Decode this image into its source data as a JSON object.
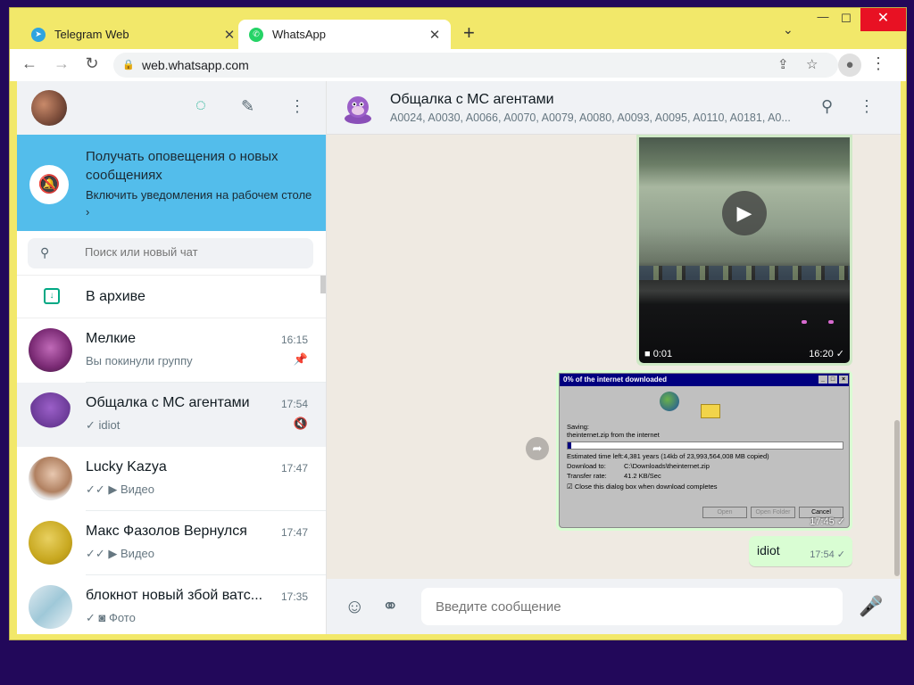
{
  "browser": {
    "tabs": [
      {
        "label": "Telegram Web",
        "active": false,
        "icon": "telegram-icon",
        "color": "#2ea4e0"
      },
      {
        "label": "WhatsApp",
        "active": true,
        "icon": "whatsapp-icon",
        "color": "#25d366"
      }
    ],
    "url": "web.whatsapp.com",
    "frame_color": "#f2e86a"
  },
  "notification": {
    "title": "Получать оповещения о новых сообщениях",
    "link": "Включить уведомления на рабочем столе ›"
  },
  "search": {
    "placeholder": "Поиск или новый чат"
  },
  "archive": {
    "label": "В архиве"
  },
  "chats": [
    {
      "name": "Мелкие",
      "time": "16:15",
      "preview": "Вы покинули группу",
      "right_icon": "pin-icon"
    },
    {
      "name": "Общалка с МС агентами",
      "time": "17:54",
      "preview": "✓ idiot",
      "right_icon": "muted-icon",
      "active": true
    },
    {
      "name": "Lucky Kazya",
      "time": "17:47",
      "preview": "✓✓ ▶ Видео"
    },
    {
      "name": "Макс Фазолов Вернулся",
      "time": "17:47",
      "preview": "✓✓ ▶ Видео"
    },
    {
      "name": "блокнот новый збой ватс...",
      "time": "17:35",
      "preview": "✓ ◙ Фото"
    }
  ],
  "conversation": {
    "title": "Общалка с МС агентами",
    "members": "A0024, A0030, A0066, A0070, A0079, A0080, A0093, A0095, A0110, A0181, A0...",
    "messages": [
      {
        "type": "video",
        "duration": "0:01",
        "time": "16:20 ✓"
      },
      {
        "type": "image",
        "time": "17:45 ✓",
        "dialog": {
          "title": "0% of the internet downloaded",
          "saving": "Saving:",
          "file": "theinternet.zip from the internet",
          "rows": [
            {
              "label": "Estimated time left:",
              "value": "4,381 years (14kb of 23,993,564,008 MB copied)"
            },
            {
              "label": "Download to:",
              "value": "C:\\Downloads\\theinternet.zip"
            },
            {
              "label": "Transfer rate:",
              "value": "41.2 KB/Sec"
            }
          ],
          "checkbox": "Close this dialog box when download completes",
          "buttons": [
            "Open",
            "Open Folder",
            "Cancel"
          ]
        }
      },
      {
        "type": "text",
        "text": "idiot",
        "time": "17:54 ✓"
      }
    ],
    "input_placeholder": "Введите сообщение"
  }
}
